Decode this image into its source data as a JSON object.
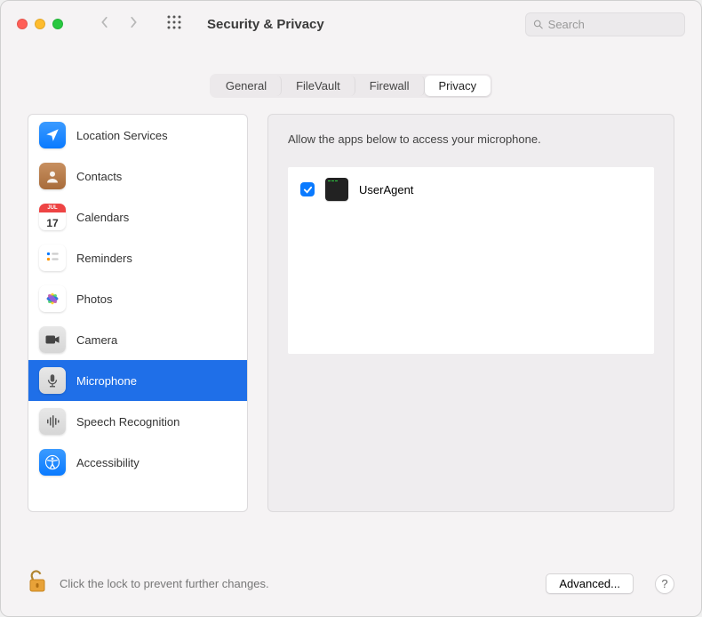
{
  "window": {
    "title": "Security & Privacy"
  },
  "search": {
    "placeholder": "Search",
    "value": ""
  },
  "tabs": [
    {
      "id": "general",
      "label": "General",
      "active": false
    },
    {
      "id": "filevault",
      "label": "FileVault",
      "active": false
    },
    {
      "id": "firewall",
      "label": "Firewall",
      "active": false
    },
    {
      "id": "privacy",
      "label": "Privacy",
      "active": true
    }
  ],
  "sidebar": {
    "items": [
      {
        "id": "location",
        "label": "Location Services",
        "icon": "location-arrow-icon",
        "bg": "bg-blue",
        "selected": false
      },
      {
        "id": "contacts",
        "label": "Contacts",
        "icon": "contacts-icon",
        "bg": "bg-brown",
        "selected": false
      },
      {
        "id": "calendars",
        "label": "Calendars",
        "icon": "calendar-icon",
        "bg": "bg-white",
        "selected": false,
        "calDay": "17",
        "calMonth": "JUL"
      },
      {
        "id": "reminders",
        "label": "Reminders",
        "icon": "reminders-icon",
        "bg": "bg-white",
        "selected": false
      },
      {
        "id": "photos",
        "label": "Photos",
        "icon": "photos-icon",
        "bg": "photos",
        "selected": false
      },
      {
        "id": "camera",
        "label": "Camera",
        "icon": "camera-icon",
        "bg": "bg-gray",
        "selected": false
      },
      {
        "id": "microphone",
        "label": "Microphone",
        "icon": "microphone-icon",
        "bg": "bg-gray",
        "selected": true
      },
      {
        "id": "speech",
        "label": "Speech Recognition",
        "icon": "speech-icon",
        "bg": "bg-gray",
        "selected": false
      },
      {
        "id": "accessibility",
        "label": "Accessibility",
        "icon": "accessibility-icon",
        "bg": "bg-blue",
        "selected": false
      }
    ]
  },
  "main": {
    "hint": "Allow the apps below to access your microphone.",
    "apps": [
      {
        "name": "UserAgent",
        "checked": true,
        "icon": "terminal-icon"
      }
    ]
  },
  "footer": {
    "lock_hint": "Click the lock to prevent further changes.",
    "advanced_label": "Advanced...",
    "help_label": "?"
  }
}
